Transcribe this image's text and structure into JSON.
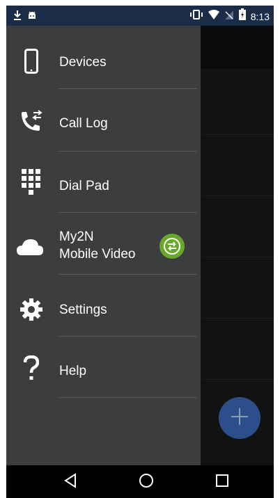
{
  "status_bar": {
    "time": "8:13",
    "left_icons": [
      "download-icon",
      "android-icon"
    ],
    "right_icons": [
      "vibrate-icon",
      "wifi-icon",
      "no-signal-icon",
      "battery-icon"
    ]
  },
  "drawer": {
    "items": [
      {
        "label": "Devices",
        "icon": "phone-device-icon"
      },
      {
        "label": "Call Log",
        "icon": "call-log-icon"
      },
      {
        "label": "Dial Pad",
        "icon": "dialpad-icon"
      },
      {
        "label_line1": "My2N",
        "label_line2": "Mobile Video",
        "icon": "cloud-icon",
        "badge_icon": "sync-badge-icon"
      },
      {
        "label": "Settings",
        "icon": "gear-icon"
      },
      {
        "label": "Help",
        "icon": "question-icon"
      }
    ]
  },
  "fab": {
    "icon": "plus-icon"
  },
  "nav_bar": {
    "buttons": [
      "back-icon",
      "home-icon",
      "recents-icon"
    ]
  },
  "colors": {
    "status_bar": "#1b2c49",
    "drawer": "#3b3d3e",
    "fab": "#2c4f8c",
    "badge": "#6aa82b"
  }
}
